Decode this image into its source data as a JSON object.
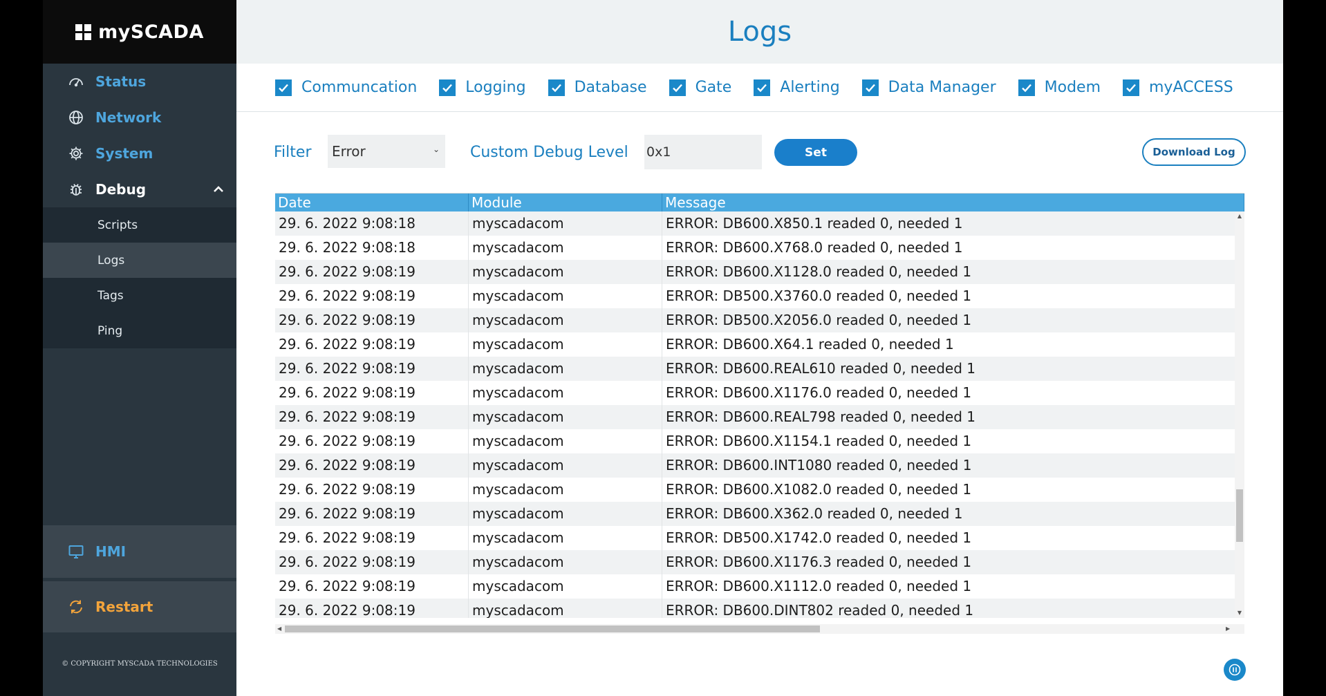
{
  "brand": {
    "name": "mySCADA"
  },
  "sidebar": {
    "items": [
      {
        "label": "Status",
        "icon": "gauge-icon"
      },
      {
        "label": "Network",
        "icon": "globe-icon"
      },
      {
        "label": "System",
        "icon": "gear-icon"
      },
      {
        "label": "Debug",
        "icon": "bug-icon"
      }
    ],
    "subitems": [
      {
        "label": "Scripts"
      },
      {
        "label": "Logs"
      },
      {
        "label": "Tags"
      },
      {
        "label": "Ping"
      }
    ],
    "hmi_label": "HMI",
    "restart_label": "Restart",
    "copyright": "© COPYRIGHT MYSCADA TECHNOLOGIES"
  },
  "page": {
    "title": "Logs"
  },
  "modules": [
    {
      "label": "Communcation",
      "checked": true
    },
    {
      "label": "Logging",
      "checked": true
    },
    {
      "label": "Database",
      "checked": true
    },
    {
      "label": "Gate",
      "checked": true
    },
    {
      "label": "Alerting",
      "checked": true
    },
    {
      "label": "Data Manager",
      "checked": true
    },
    {
      "label": "Modem",
      "checked": true
    },
    {
      "label": "myACCESS",
      "checked": true
    }
  ],
  "filter": {
    "label": "Filter",
    "value": "Error",
    "debug_label": "Custom Debug Level",
    "debug_value": "0x1",
    "set_label": "Set",
    "download_label": "Download Log"
  },
  "table": {
    "columns": [
      "Date",
      "Module",
      "Message"
    ],
    "rows": [
      [
        "29. 6. 2022 9:08:18",
        "myscadacom",
        "ERROR: DB600.X850.1 readed  0, needed 1"
      ],
      [
        "29. 6. 2022 9:08:18",
        "myscadacom",
        "ERROR: DB600.X768.0 readed  0, needed 1"
      ],
      [
        "29. 6. 2022 9:08:19",
        "myscadacom",
        "ERROR: DB600.X1128.0 readed  0, needed 1"
      ],
      [
        "29. 6. 2022 9:08:19",
        "myscadacom",
        "ERROR: DB500.X3760.0 readed  0, needed 1"
      ],
      [
        "29. 6. 2022 9:08:19",
        "myscadacom",
        "ERROR: DB500.X2056.0 readed  0, needed 1"
      ],
      [
        "29. 6. 2022 9:08:19",
        "myscadacom",
        "ERROR: DB600.X64.1 readed  0, needed 1"
      ],
      [
        "29. 6. 2022 9:08:19",
        "myscadacom",
        "ERROR: DB600.REAL610 readed  0, needed 1"
      ],
      [
        "29. 6. 2022 9:08:19",
        "myscadacom",
        "ERROR: DB600.X1176.0 readed  0, needed 1"
      ],
      [
        "29. 6. 2022 9:08:19",
        "myscadacom",
        "ERROR: DB600.REAL798 readed  0, needed 1"
      ],
      [
        "29. 6. 2022 9:08:19",
        "myscadacom",
        "ERROR: DB600.X1154.1 readed  0, needed 1"
      ],
      [
        "29. 6. 2022 9:08:19",
        "myscadacom",
        "ERROR: DB600.INT1080 readed  0, needed 1"
      ],
      [
        "29. 6. 2022 9:08:19",
        "myscadacom",
        "ERROR: DB600.X1082.0 readed  0, needed 1"
      ],
      [
        "29. 6. 2022 9:08:19",
        "myscadacom",
        "ERROR: DB600.X362.0 readed  0, needed 1"
      ],
      [
        "29. 6. 2022 9:08:19",
        "myscadacom",
        "ERROR: DB500.X1742.0 readed  0, needed 1"
      ],
      [
        "29. 6. 2022 9:08:19",
        "myscadacom",
        "ERROR: DB600.X1176.3 readed  0, needed 1"
      ],
      [
        "29. 6. 2022 9:08:19",
        "myscadacom",
        "ERROR: DB600.X1112.0 readed  0, needed 1"
      ],
      [
        "29. 6. 2022 9:08:19",
        "myscadacom",
        "ERROR: DB600.DINT802 readed  0, needed 1"
      ]
    ]
  },
  "colors": {
    "accent": "#1a7fbf",
    "header": "#4aa9df",
    "sidebar": "#2a363f",
    "restart": "#f3a43b"
  }
}
